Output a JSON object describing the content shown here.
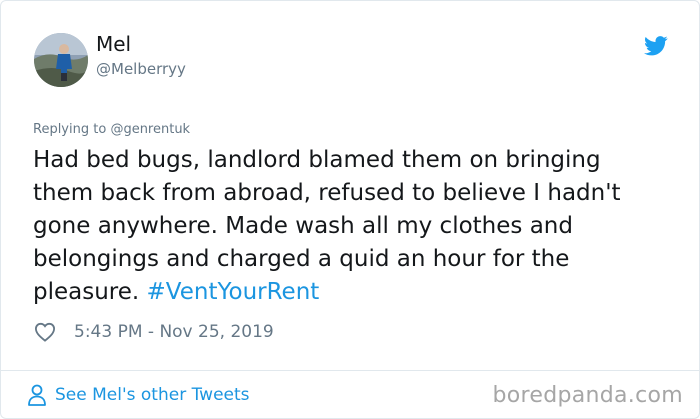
{
  "tweet": {
    "display_name": "Mel",
    "handle": "@Melberryy",
    "replying_prefix": "Replying to ",
    "replying_to": "@genrentuk",
    "text_lines": [
      "Had bed bugs, landlord blamed them on bringing",
      "them back from abroad, refused to believe I hadn't",
      "gone anywhere. Made wash all my clothes and",
      "belongings and charged a quid an hour for the",
      "pleasure. "
    ],
    "hashtag": "#VentYourRent",
    "timestamp": "5:43 PM - Nov 25, 2019",
    "see_more": "See Mel's other Tweets"
  },
  "watermark": "boredpanda.com",
  "icons": {
    "brand": "twitter-bird-icon",
    "like": "heart-icon",
    "profile": "person-icon"
  },
  "colors": {
    "twitter_blue": "#1da1f2",
    "link_blue": "#1b95e0",
    "muted_gray": "#657786",
    "text": "#14171a"
  }
}
